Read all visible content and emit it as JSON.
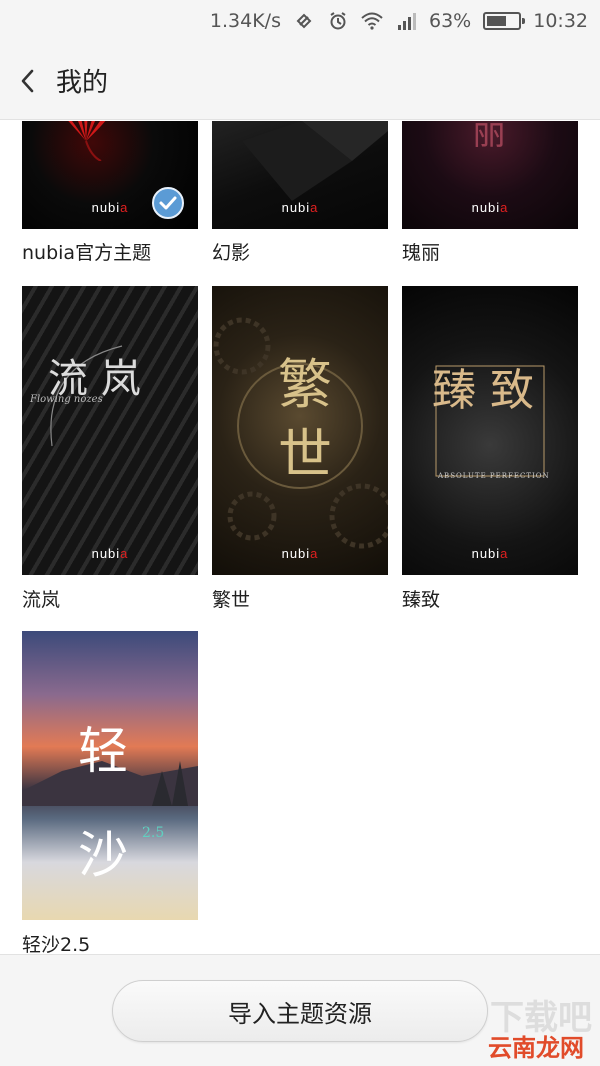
{
  "status_bar": {
    "speed": "1.34K/s",
    "battery_percent": "63%",
    "battery_level": 0.63,
    "time": "10:32",
    "icons": [
      "nfc-icon",
      "alarm-icon",
      "wifi-icon",
      "signal-icon",
      "battery-icon"
    ]
  },
  "header": {
    "back_icon": "chevron-left-icon",
    "title": "我的"
  },
  "themes": [
    {
      "name": "nubia官方主题",
      "brand": "nubia",
      "selected": true
    },
    {
      "name": "幻影",
      "brand": "nubia",
      "selected": false
    },
    {
      "name": "瑰丽",
      "brand": "nubia",
      "selected": false,
      "art_text": "丽"
    },
    {
      "name": "流岚",
      "brand": "nubia",
      "selected": false,
      "art_text": "流 岚",
      "art_sub": "Flowing nozes"
    },
    {
      "name": "繁世",
      "brand": "nubia",
      "selected": false,
      "art_text": "繁 世"
    },
    {
      "name": "臻致",
      "brand": "nubia",
      "selected": false,
      "art_text": "臻 致",
      "art_sub": "ABSOLUTE PERFECTION"
    },
    {
      "name": "轻沙2.5",
      "selected": false,
      "art_text": "轻 沙",
      "art_sub": "2.5"
    }
  ],
  "footer": {
    "import_button": "导入主题资源"
  },
  "watermark": {
    "big": "下载吧",
    "small": "云南龙网"
  },
  "colors": {
    "accent_check": "#5b9bd5",
    "brand_accent": "#e02020",
    "background": "#ffffff",
    "bar": "#f5f5f5"
  }
}
